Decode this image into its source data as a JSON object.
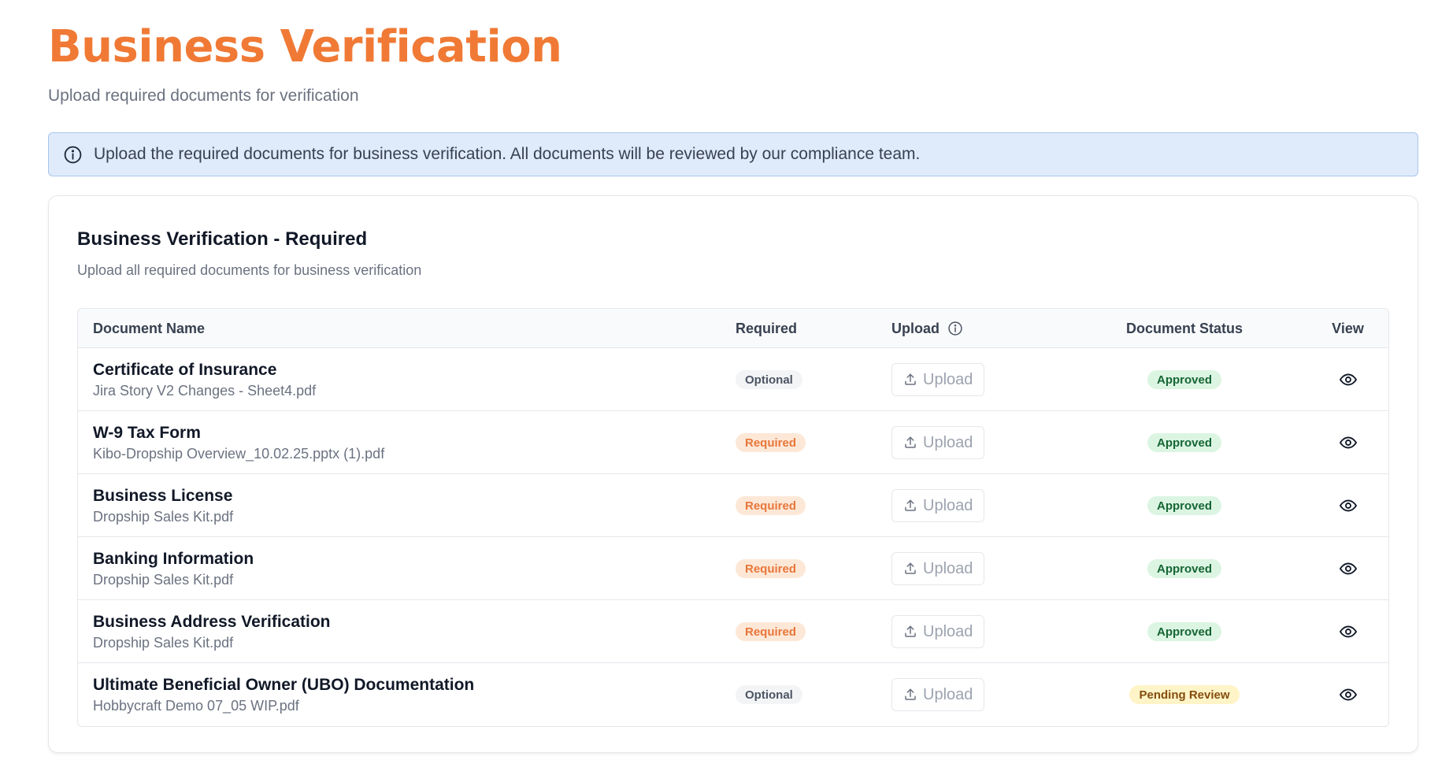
{
  "header": {
    "title": "Business Verification",
    "subtitle": "Upload required documents for verification"
  },
  "info_banner": {
    "icon": "info-icon",
    "text": "Upload the required documents for business verification. All documents will be reviewed by our compliance team."
  },
  "card": {
    "title": "Business Verification - Required",
    "subtitle": "Upload all required documents for business verification"
  },
  "table": {
    "columns": {
      "name": "Document Name",
      "required": "Required",
      "upload": "Upload",
      "status": "Document Status",
      "view": "View"
    },
    "rows": [
      {
        "name": "Certificate of Insurance",
        "file": "Jira Story V2 Changes - Sheet4.pdf",
        "required": "Optional",
        "upload_label": "Upload",
        "status": "Approved"
      },
      {
        "name": "W-9 Tax Form",
        "file": "Kibo-Dropship Overview_10.02.25.pptx (1).pdf",
        "required": "Required",
        "upload_label": "Upload",
        "status": "Approved"
      },
      {
        "name": "Business License",
        "file": "Dropship Sales Kit.pdf",
        "required": "Required",
        "upload_label": "Upload",
        "status": "Approved"
      },
      {
        "name": "Banking Information",
        "file": "Dropship Sales Kit.pdf",
        "required": "Required",
        "upload_label": "Upload",
        "status": "Approved"
      },
      {
        "name": "Business Address Verification",
        "file": "Dropship Sales Kit.pdf",
        "required": "Required",
        "upload_label": "Upload",
        "status": "Approved"
      },
      {
        "name": "Ultimate Beneficial Owner (UBO) Documentation",
        "file": "Hobbycraft Demo 07_05 WIP.pdf",
        "required": "Optional",
        "upload_label": "Upload",
        "status": "Pending Review"
      }
    ]
  },
  "colors": {
    "accent": "#f07a35",
    "banner_bg": "#dfeafb",
    "approved": "#166534",
    "pending": "#854d0e",
    "required_badge": "#e8763a"
  }
}
